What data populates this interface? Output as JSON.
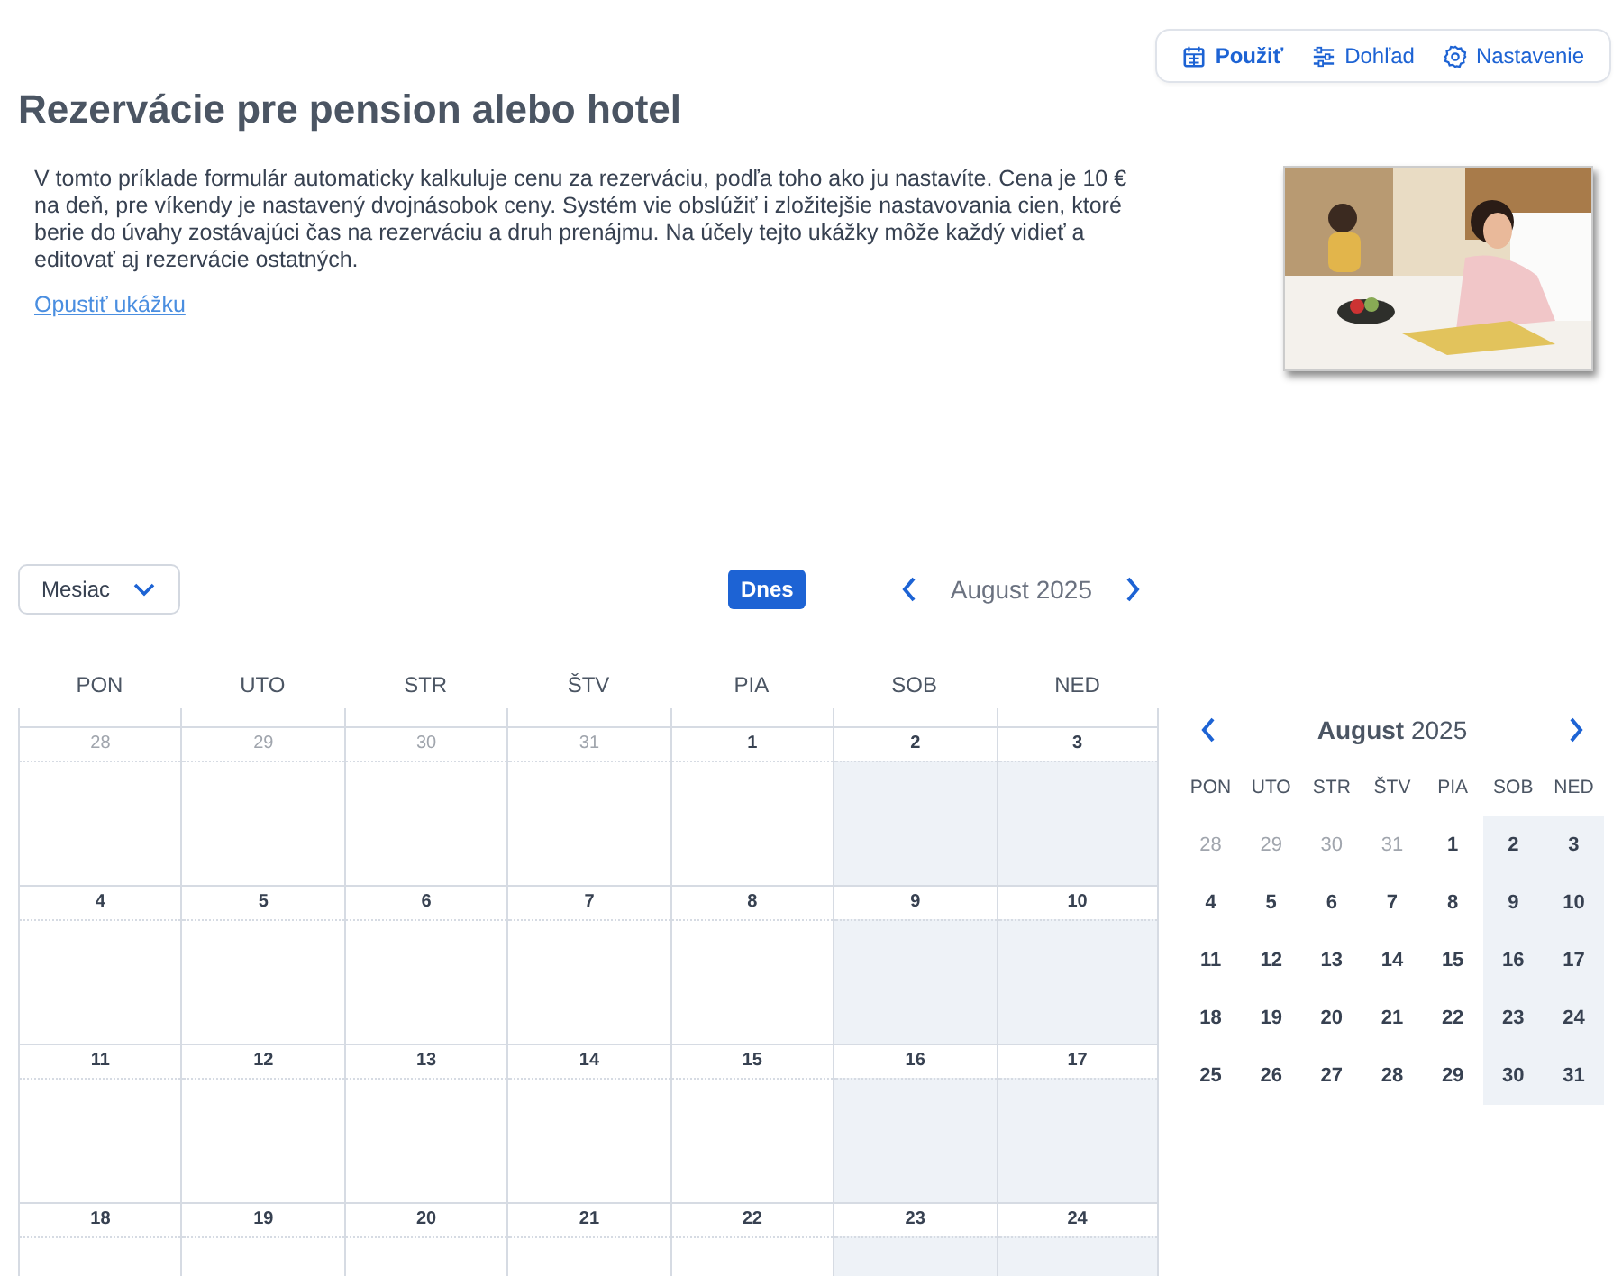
{
  "toolbar": [
    {
      "label": "Použiť",
      "selected": true
    },
    {
      "label": "Dohľad",
      "selected": false
    },
    {
      "label": "Nastavenie",
      "selected": false
    }
  ],
  "title": "Rezervácie pre pension alebo hotel",
  "description": "V tomto príklade formulár automaticky kalkuluje cenu za rezerváciu, podľa toho ako ju nastavíte. Cena je 10 € na deň, pre víkendy je nastavený dvojnásobok ceny. Systém vie obslúžiť i zložitejšie nastavovania cien, ktoré berie do úvahy zostávajúci čas na rezerváciu a druh prenájmu. Na účely tejto ukážky môže každý vidieť a editovať aj rezervácie ostatných.",
  "exit_link": "Opustiť ukážku",
  "view_select": {
    "value": "Mesiac"
  },
  "today_button": "Dnes",
  "period": "August 2025",
  "calendar": {
    "weekdays": [
      "PON",
      "UTO",
      "STR",
      "ŠTV",
      "PIA",
      "SOB",
      "NED"
    ],
    "weeks": [
      [
        {
          "day": "28",
          "outside": true
        },
        {
          "day": "29",
          "outside": true
        },
        {
          "day": "30",
          "outside": true
        },
        {
          "day": "31",
          "outside": true
        },
        {
          "day": "1",
          "outside": false
        },
        {
          "day": "2",
          "outside": false
        },
        {
          "day": "3",
          "outside": false
        }
      ],
      [
        {
          "day": "4",
          "outside": false
        },
        {
          "day": "5",
          "outside": false
        },
        {
          "day": "6",
          "outside": false
        },
        {
          "day": "7",
          "outside": false
        },
        {
          "day": "8",
          "outside": false
        },
        {
          "day": "9",
          "outside": false
        },
        {
          "day": "10",
          "outside": false
        }
      ],
      [
        {
          "day": "11",
          "outside": false
        },
        {
          "day": "12",
          "outside": false
        },
        {
          "day": "13",
          "outside": false
        },
        {
          "day": "14",
          "outside": false
        },
        {
          "day": "15",
          "outside": false
        },
        {
          "day": "16",
          "outside": false
        },
        {
          "day": "17",
          "outside": false
        }
      ],
      [
        {
          "day": "18",
          "outside": false
        },
        {
          "day": "19",
          "outside": false
        },
        {
          "day": "20",
          "outside": false
        },
        {
          "day": "21",
          "outside": false
        },
        {
          "day": "22",
          "outside": false
        },
        {
          "day": "23",
          "outside": false
        },
        {
          "day": "24",
          "outside": false
        }
      ]
    ]
  },
  "mini_calendar": {
    "title": "**August** 2025",
    "weekdays": [
      "PON",
      "UTO",
      "STR",
      "ŠTV",
      "PIA",
      "SOB",
      "NED"
    ],
    "weeks": [
      [
        {
          "day": "28",
          "outside": true
        },
        {
          "day": "29",
          "outside": true
        },
        {
          "day": "30",
          "outside": true
        },
        {
          "day": "31",
          "outside": true
        },
        {
          "day": "1",
          "outside": false
        },
        {
          "day": "2",
          "outside": false
        },
        {
          "day": "3",
          "outside": false
        }
      ],
      [
        {
          "day": "4",
          "outside": false
        },
        {
          "day": "5",
          "outside": false
        },
        {
          "day": "6",
          "outside": false
        },
        {
          "day": "7",
          "outside": false
        },
        {
          "day": "8",
          "outside": false
        },
        {
          "day": "9",
          "outside": false
        },
        {
          "day": "10",
          "outside": false
        }
      ],
      [
        {
          "day": "11",
          "outside": false
        },
        {
          "day": "12",
          "outside": false
        },
        {
          "day": "13",
          "outside": false
        },
        {
          "day": "14",
          "outside": false
        },
        {
          "day": "15",
          "outside": false
        },
        {
          "day": "16",
          "outside": false
        },
        {
          "day": "17",
          "outside": false
        }
      ],
      [
        {
          "day": "18",
          "outside": false
        },
        {
          "day": "19",
          "outside": false
        },
        {
          "day": "20",
          "outside": false
        },
        {
          "day": "21",
          "outside": false
        },
        {
          "day": "22",
          "outside": false
        },
        {
          "day": "23",
          "outside": false
        },
        {
          "day": "24",
          "outside": false
        }
      ],
      [
        {
          "day": "25",
          "outside": false
        },
        {
          "day": "26",
          "outside": false
        },
        {
          "day": "27",
          "outside": false
        },
        {
          "day": "28",
          "outside": false
        },
        {
          "day": "29",
          "outside": false
        },
        {
          "day": "30",
          "outside": false
        },
        {
          "day": "31",
          "outside": false
        }
      ]
    ]
  }
}
